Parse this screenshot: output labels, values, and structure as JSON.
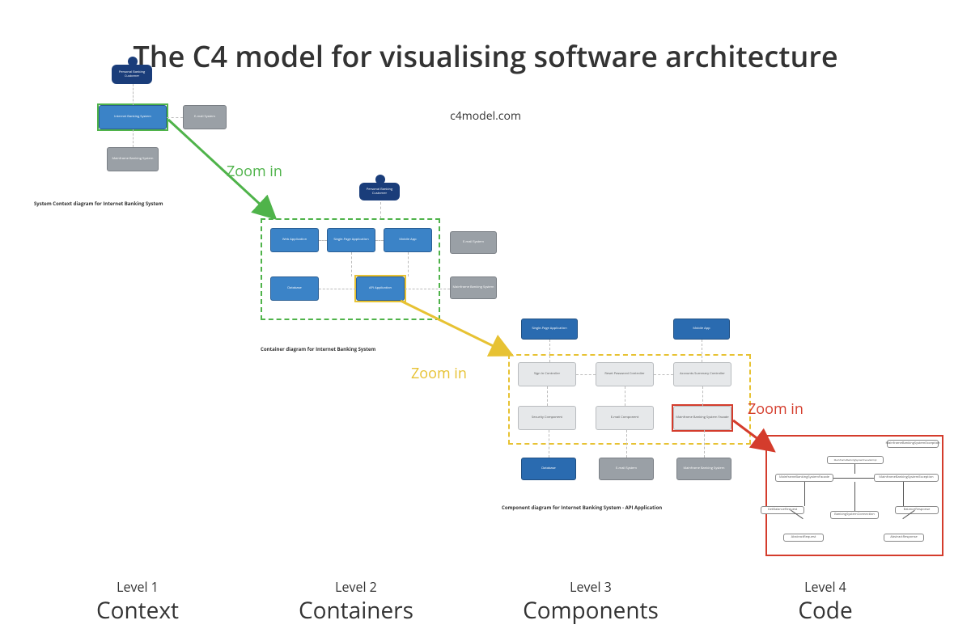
{
  "title": "The C4 model for visualising software architecture",
  "subtitle": "c4model.com",
  "zoom_labels": {
    "z1": "Zoom in",
    "z2": "Zoom in",
    "z3": "Zoom in"
  },
  "levels": [
    {
      "level": "Level 1",
      "name": "Context"
    },
    {
      "level": "Level 2",
      "name": "Containers"
    },
    {
      "level": "Level 3",
      "name": "Components"
    },
    {
      "level": "Level 4",
      "name": "Code"
    }
  ],
  "arrows": {
    "green": "#4fb34a",
    "yellow": "#e7c233",
    "red": "#d43c2c"
  },
  "l1": {
    "caption": "System Context diagram for Internet Banking System",
    "actor": "Personal Banking Customer",
    "system": "Internet Banking System",
    "email": "E-mail System",
    "mainframe": "Mainframe Banking System"
  },
  "l2": {
    "caption": "Container diagram for Internet Banking System",
    "actor": "Personal Banking Customer",
    "web": "Web Application",
    "spa": "Single-Page Application",
    "mobile": "Mobile App",
    "api": "API Application",
    "db": "Database",
    "email": "E-mail System",
    "mainframe": "Mainframe Banking System"
  },
  "l3": {
    "caption": "Component diagram for Internet Banking System - API Application",
    "spa": "Single-Page Application",
    "mobile": "Mobile App",
    "signin": "Sign In Controller",
    "reset": "Reset Password Controller",
    "accounts": "Accounts Summary Controller",
    "security": "Security Component",
    "emailcomp": "E-mail Component",
    "facade": "Mainframe Banking System Facade",
    "db": "Database",
    "email": "E-mail System",
    "mainframe": "Mainframe Banking System"
  },
  "l4": {
    "nodes": [
      "MainframeBankingSystemFacadeImpl",
      "MainframeBankingSystemFacade",
      "MainframeBankingSystemException",
      "GetBalanceRequest",
      "BankingSystemConnection",
      "BalanceResponse",
      "AbstractRequest",
      "AbstractResponse"
    ]
  }
}
